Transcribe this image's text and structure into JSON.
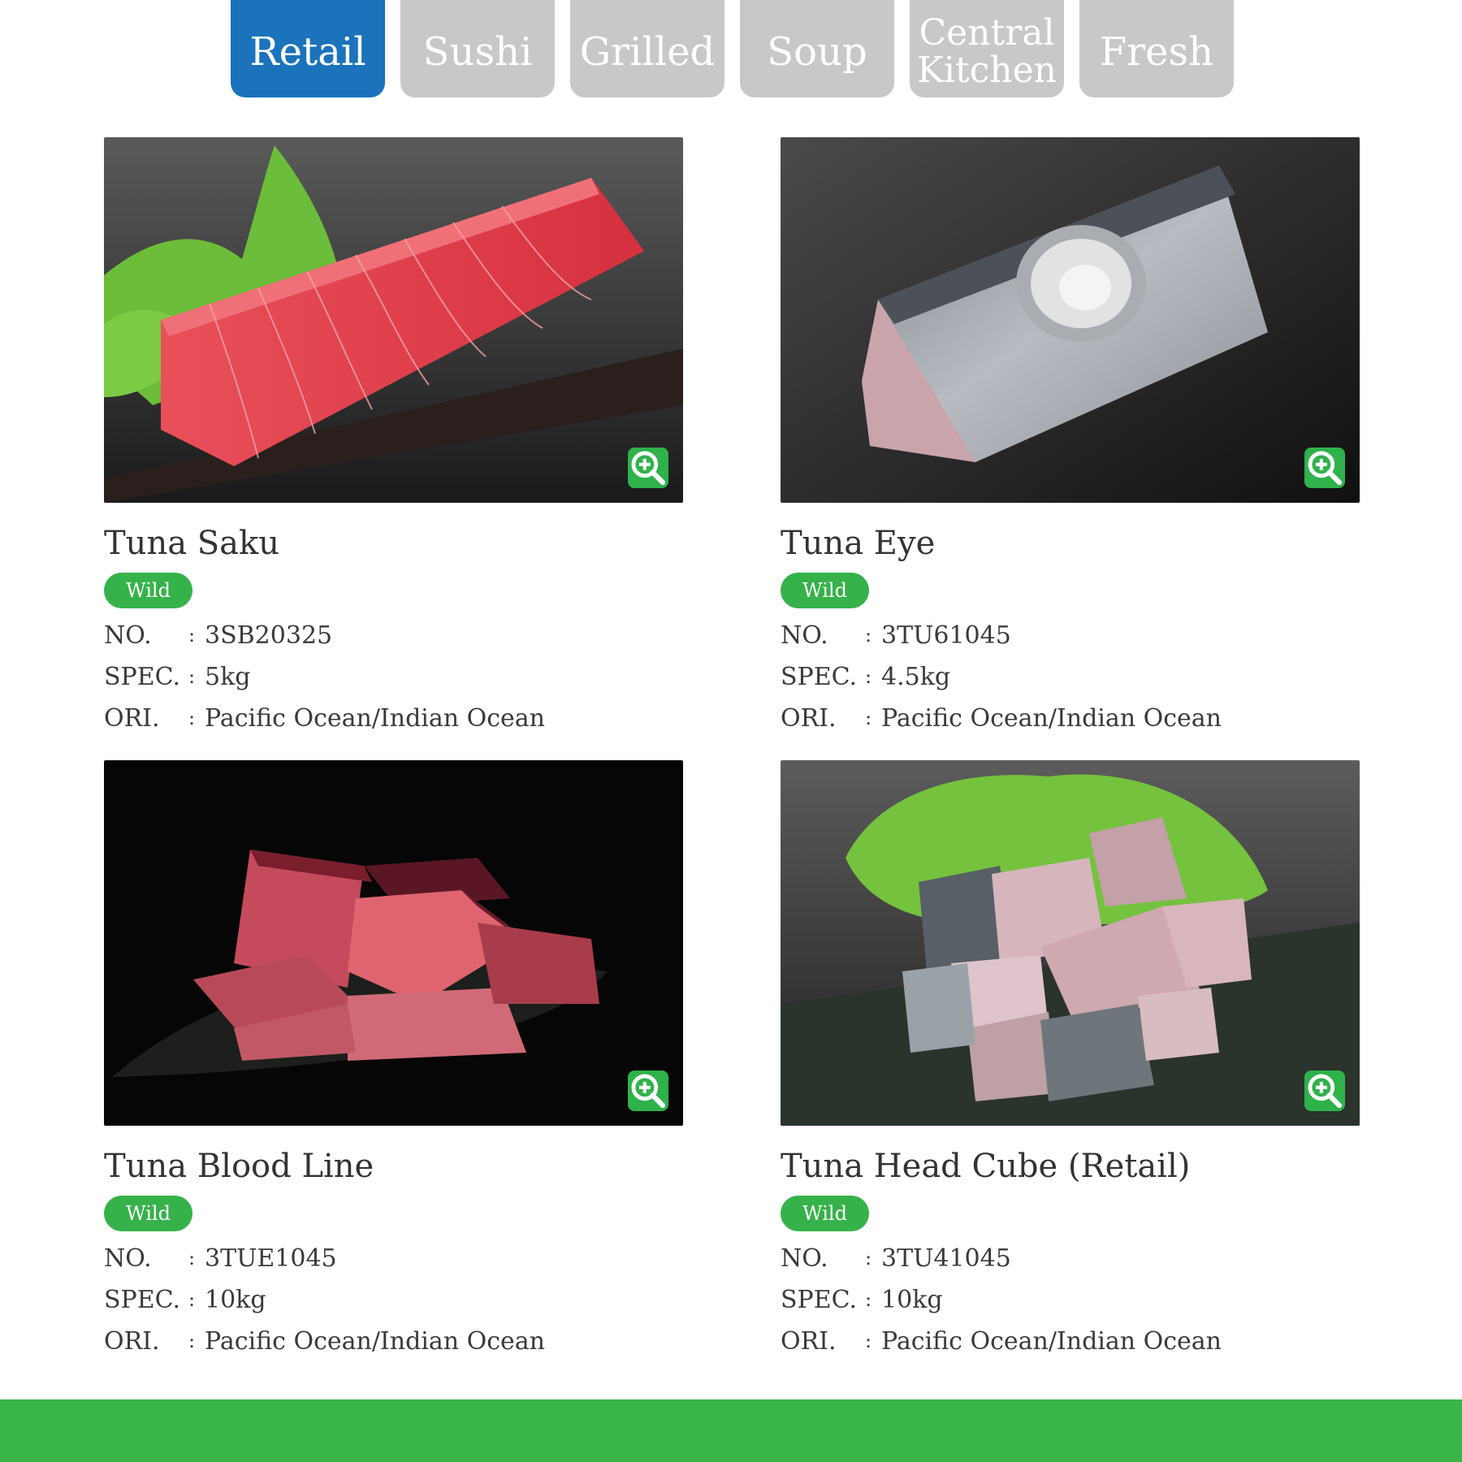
{
  "tabs": [
    {
      "label": "Retail",
      "active": true
    },
    {
      "label": "Sushi",
      "active": false
    },
    {
      "label": "Grilled",
      "active": false
    },
    {
      "label": "Soup",
      "active": false
    },
    {
      "label": "Central Kitchen",
      "active": false
    },
    {
      "label": "Fresh",
      "active": false
    }
  ],
  "spec_labels": {
    "no": "NO.",
    "spec": "SPEC.",
    "ori": "ORI.",
    "colon": ":"
  },
  "products": [
    {
      "name": "Tuna Saku",
      "badge": "Wild",
      "no": "3SB20325",
      "spec": "5kg",
      "ori": "Pacific Ocean/Indian Ocean"
    },
    {
      "name": "Tuna Eye",
      "badge": "Wild",
      "no": "3TU61045",
      "spec": "4.5kg",
      "ori": "Pacific Ocean/Indian Ocean"
    },
    {
      "name": "Tuna Blood Line",
      "badge": "Wild",
      "no": "3TUE1045",
      "spec": "10kg",
      "ori": "Pacific Ocean/Indian Ocean"
    },
    {
      "name": "Tuna Head Cube (Retail)",
      "badge": "Wild",
      "no": "3TU41045",
      "spec": "10kg",
      "ori": "Pacific Ocean/Indian Ocean"
    }
  ],
  "icons": {
    "zoom": "zoom-in-icon"
  },
  "colors": {
    "tab_active": "#1a73bb",
    "tab_inactive": "#c8c8c8",
    "badge": "#36b24a",
    "footer": "#3ab54a",
    "zoom_button": "#2fb24a"
  }
}
